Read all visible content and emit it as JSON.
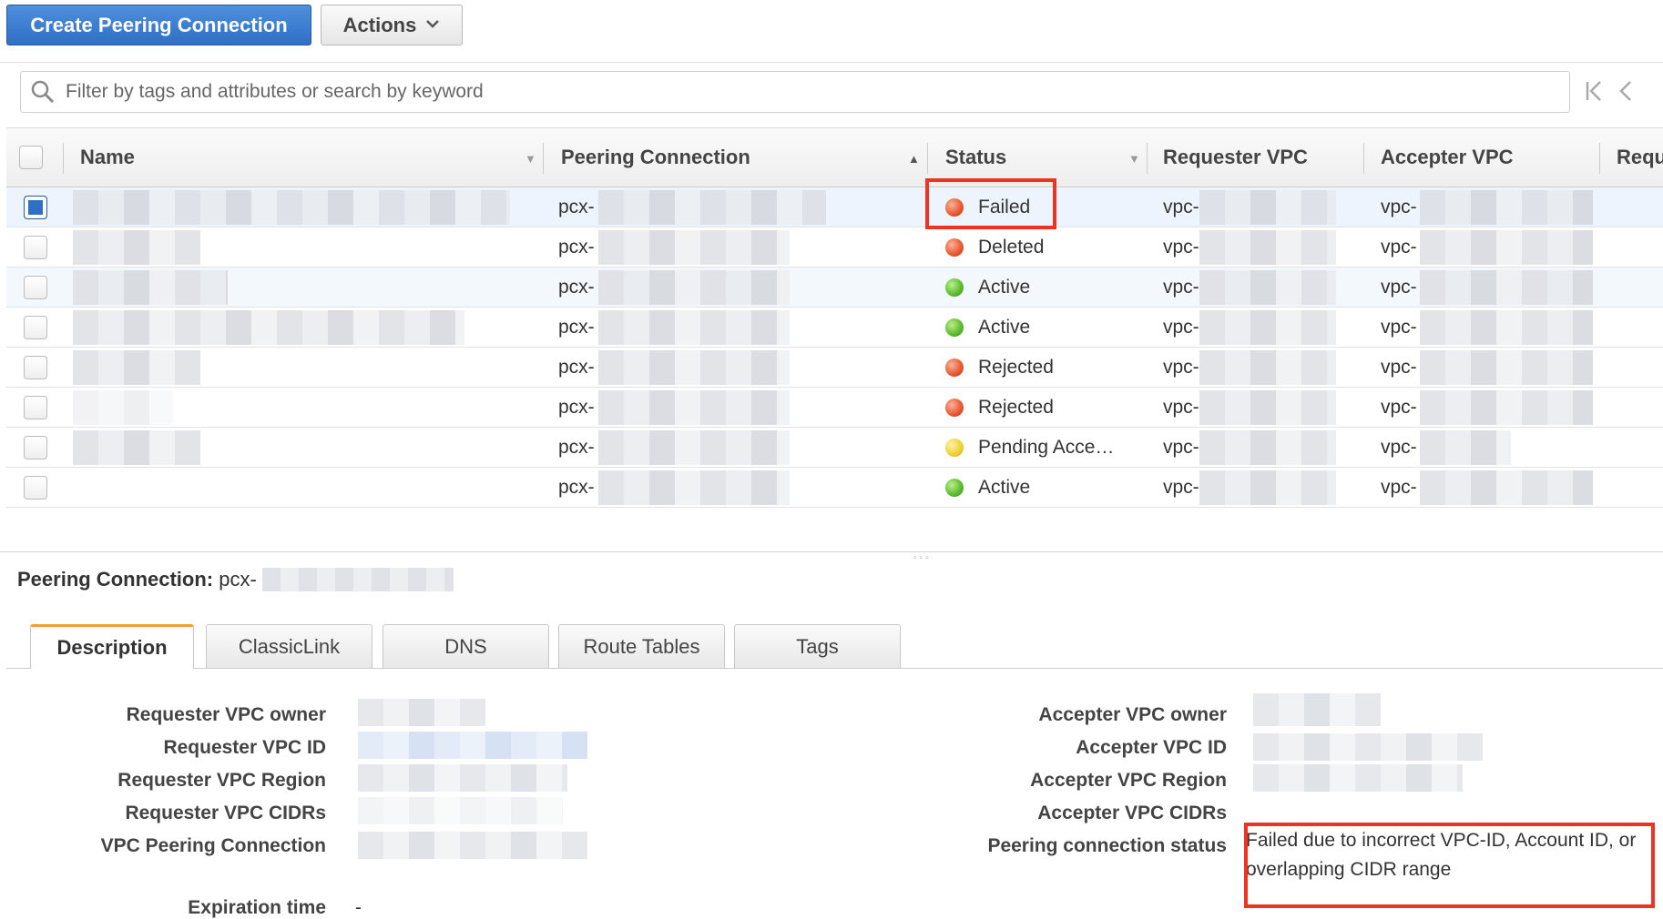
{
  "toolbar": {
    "create_label": "Create Peering Connection",
    "actions_label": "Actions"
  },
  "search": {
    "placeholder": "Filter by tags and attributes or search by keyword"
  },
  "table": {
    "columns": [
      "Name",
      "Peering Connection",
      "Status",
      "Requester VPC",
      "Accepter VPC",
      "Requ"
    ],
    "rows": [
      {
        "peering_prefix": "pcx-",
        "status": "Failed",
        "status_color": "#e4572e",
        "requester_prefix": "vpc-",
        "accepter_prefix": "vpc-"
      },
      {
        "peering_prefix": "pcx-",
        "status": "Deleted",
        "status_color": "#e4572e",
        "requester_prefix": "vpc-",
        "accepter_prefix": "vpc-"
      },
      {
        "peering_prefix": "pcx-",
        "status": "Active",
        "status_color": "#5cb82e",
        "requester_prefix": "vpc-",
        "accepter_prefix": "vpc-"
      },
      {
        "peering_prefix": "pcx-",
        "status": "Active",
        "status_color": "#5cb82e",
        "requester_prefix": "vpc-",
        "accepter_prefix": "vpc-"
      },
      {
        "peering_prefix": "pcx-",
        "status": "Rejected",
        "status_color": "#e4572e",
        "requester_prefix": "vpc-",
        "accepter_prefix": "vpc-"
      },
      {
        "peering_prefix": "pcx-",
        "status": "Rejected",
        "status_color": "#e4572e",
        "requester_prefix": "vpc-",
        "accepter_prefix": "vpc-"
      },
      {
        "peering_prefix": "pcx-",
        "status": "Pending Acce…",
        "status_color": "#f0cc33",
        "requester_prefix": "vpc-",
        "accepter_prefix": "vpc-"
      },
      {
        "peering_prefix": "pcx-",
        "status": "Active",
        "status_color": "#5cb82e",
        "requester_prefix": "vpc-",
        "accepter_prefix": "vpc-"
      }
    ]
  },
  "details": {
    "title_label": "Peering Connection:",
    "title_prefix": "pcx-",
    "tabs": [
      "Description",
      "ClassicLink",
      "DNS",
      "Route Tables",
      "Tags"
    ],
    "left_labels": [
      "Requester VPC owner",
      "Requester VPC ID",
      "Requester VPC Region",
      "Requester VPC CIDRs",
      "VPC Peering Connection",
      "Expiration time"
    ],
    "right_labels": [
      "Accepter VPC owner",
      "Accepter VPC ID",
      "Accepter VPC Region",
      "Accepter VPC CIDRs",
      "Peering connection status"
    ],
    "expiration_value": "-",
    "status_message": "Failed due to incorrect VPC-ID, Account ID, or overlapping CIDR range"
  }
}
